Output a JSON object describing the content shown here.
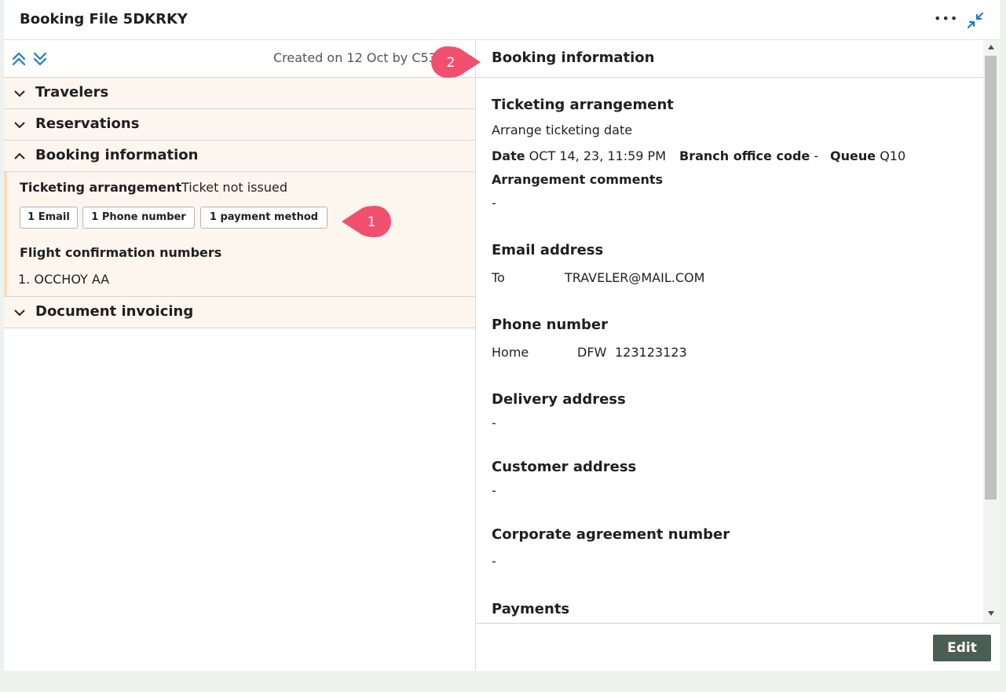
{
  "header": {
    "title": "Booking File 5DKRKY",
    "more_icon": "more-horizontal-icon",
    "minimize_icon": "minimize-icon"
  },
  "colors": {
    "accent_blue": "#1a7fc4",
    "section_bg": "#fdf6ef",
    "callout": "#f0506e",
    "edit_button": "#4b5e55"
  },
  "left": {
    "created": "Created on 12 Oct by C53",
    "sections": [
      {
        "label": "Travelers",
        "expanded": false
      },
      {
        "label": "Reservations",
        "expanded": false
      },
      {
        "label": "Booking information",
        "expanded": true
      },
      {
        "label": "Document invoicing",
        "expanded": false
      }
    ],
    "booking": {
      "ticketing_label": "Ticketing arrangement",
      "ticketing_value": "Ticket not issued",
      "chips": [
        "1 Email",
        "1 Phone number",
        "1 payment method"
      ],
      "fcn_label": "Flight confirmation numbers",
      "fcn_value": "1. OCCHOY AA"
    }
  },
  "callouts": [
    "1",
    "2"
  ],
  "right": {
    "title": "Booking information",
    "ticketing": {
      "heading": "Ticketing arrangement",
      "subtitle": "Arrange ticketing date",
      "date_label": "Date",
      "date_value": "OCT 14, 23, 11:59 PM",
      "branch_label": "Branch office code",
      "branch_value": "-",
      "queue_label": "Queue",
      "queue_value": "Q10",
      "comments_label": "Arrangement comments",
      "comments_value": "-"
    },
    "email": {
      "heading": "Email address",
      "type": "To",
      "value": "TRAVELER@MAIL.COM"
    },
    "phone": {
      "heading": "Phone number",
      "type": "Home",
      "city": "DFW",
      "number": "123123123"
    },
    "delivery": {
      "heading": "Delivery address",
      "value": "-"
    },
    "customer": {
      "heading": "Customer address",
      "value": "-"
    },
    "corporate": {
      "heading": "Corporate agreement number",
      "value": "-"
    },
    "payments": {
      "heading": "Payments"
    },
    "edit_label": "Edit"
  }
}
